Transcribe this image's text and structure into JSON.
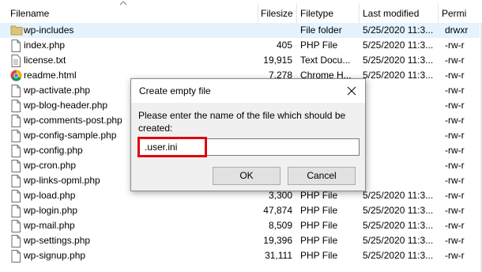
{
  "columns": {
    "name": "Filename",
    "size": "Filesize",
    "type": "Filetype",
    "modified": "Last modified",
    "perms": "Permi"
  },
  "files": [
    {
      "name": "wp-includes",
      "size": "",
      "type": "File folder",
      "modified": "5/25/2020 11:3...",
      "perms": "drwxr",
      "icon": "folder-icon"
    },
    {
      "name": "index.php",
      "size": "405",
      "type": "PHP File",
      "modified": "5/25/2020 11:3...",
      "perms": "-rw-r",
      "icon": "file-icon"
    },
    {
      "name": "license.txt",
      "size": "19,915",
      "type": "Text Docu...",
      "modified": "5/25/2020 11:3...",
      "perms": "-rw-r",
      "icon": "text-file-icon"
    },
    {
      "name": "readme.html",
      "size": "7,278",
      "type": "Chrome H...",
      "modified": "5/25/2020 11:3...",
      "perms": "-rw-r",
      "icon": "chrome-icon"
    },
    {
      "name": "wp-activate.php",
      "size": "",
      "type": "",
      "modified": "",
      "perms": "-rw-r",
      "icon": "file-icon"
    },
    {
      "name": "wp-blog-header.php",
      "size": "",
      "type": "",
      "modified": "",
      "perms": "-rw-r",
      "icon": "file-icon"
    },
    {
      "name": "wp-comments-post.php",
      "size": "",
      "type": "",
      "modified": "",
      "perms": "-rw-r",
      "icon": "file-icon"
    },
    {
      "name": "wp-config-sample.php",
      "size": "",
      "type": "",
      "modified": "",
      "perms": "-rw-r",
      "icon": "file-icon"
    },
    {
      "name": "wp-config.php",
      "size": "",
      "type": "",
      "modified": "",
      "perms": "-rw-r",
      "icon": "file-icon"
    },
    {
      "name": "wp-cron.php",
      "size": "",
      "type": "",
      "modified": "",
      "perms": "-rw-r",
      "icon": "file-icon"
    },
    {
      "name": "wp-links-opml.php",
      "size": "",
      "type": "",
      "modified": "",
      "perms": "-rw-r",
      "icon": "file-icon"
    },
    {
      "name": "wp-load.php",
      "size": "3,300",
      "type": "PHP File",
      "modified": "5/25/2020 11:3...",
      "perms": "-rw-r",
      "icon": "file-icon"
    },
    {
      "name": "wp-login.php",
      "size": "47,874",
      "type": "PHP File",
      "modified": "5/25/2020 11:3...",
      "perms": "-rw-r",
      "icon": "file-icon"
    },
    {
      "name": "wp-mail.php",
      "size": "8,509",
      "type": "PHP File",
      "modified": "5/25/2020 11:3...",
      "perms": "-rw-r",
      "icon": "file-icon"
    },
    {
      "name": "wp-settings.php",
      "size": "19,396",
      "type": "PHP File",
      "modified": "5/25/2020 11:3...",
      "perms": "-rw-r",
      "icon": "file-icon"
    },
    {
      "name": "wp-signup.php",
      "size": "31,111",
      "type": "PHP File",
      "modified": "5/25/2020 11:3...",
      "perms": "-rw-r",
      "icon": "file-icon"
    }
  ],
  "dialog": {
    "title": "Create empty file",
    "prompt": "Please enter the name of the file which should be created:",
    "value": ".user.ini",
    "ok_label": "OK",
    "cancel_label": "Cancel",
    "highlight_color": "#e0000f"
  },
  "colors": {
    "selected_row": "#e5f3ff",
    "folder": "#dcc57a"
  }
}
